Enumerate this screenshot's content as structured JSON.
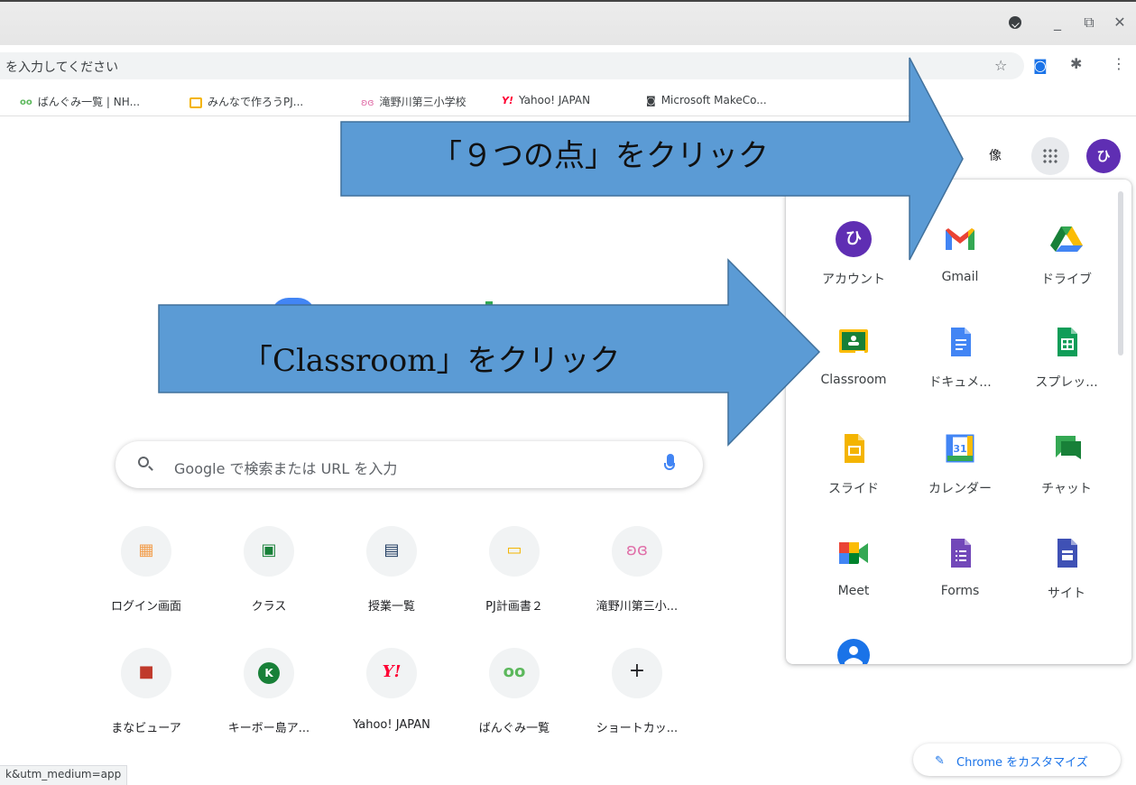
{
  "window": {
    "minimize": "_",
    "restore": "⧉",
    "close": "✕"
  },
  "omnibox": {
    "text": "を入力してください"
  },
  "bookmarks": [
    {
      "label": "ばんぐみ一覧 | NH...",
      "icon": "nhk-icon",
      "color": "#5cb85c"
    },
    {
      "label": "みんなで作ろうPJ...",
      "icon": "slides-icon",
      "color": "#f4b400"
    },
    {
      "label": "滝野川第三小学校",
      "icon": "school-icon",
      "color": "#e06fa8"
    },
    {
      "label": "Yahoo! JAPAN",
      "icon": "yahoo-icon",
      "color": "#ff0033"
    },
    {
      "label": "Microsoft MakeCo...",
      "icon": "makecode-icon",
      "color": "#3c4043"
    }
  ],
  "header": {
    "partial_text": "像",
    "avatar_letter": "ひ"
  },
  "search": {
    "placeholder": "Google で検索または URL を入力"
  },
  "shortcuts_row1": [
    {
      "label": "ログイン画面",
      "glyph": "▦",
      "color": "#f29e4c"
    },
    {
      "label": "クラス",
      "glyph": "▣",
      "color": "#188038"
    },
    {
      "label": "授業一覧",
      "glyph": "▤",
      "color": "#1e3a5f"
    },
    {
      "label": "PJ計画書２",
      "glyph": "▭",
      "color": "#f4b400"
    },
    {
      "label": "滝野川第三小...",
      "glyph": "ʚɞ",
      "color": "#e06fa8"
    }
  ],
  "shortcuts_row2": [
    {
      "label": "まなビューア",
      "glyph": "■",
      "color": "#c0392b"
    },
    {
      "label": "キーボー島ア...",
      "glyph": "K",
      "color": "#ffffff"
    },
    {
      "label": "Yahoo! JAPAN",
      "glyph": "Y!",
      "color": "#ff0033"
    },
    {
      "label": "ばんぐみ一覧",
      "glyph": "oo",
      "color": "#5cb85c"
    },
    {
      "label": "ショートカッ...",
      "glyph": "+",
      "color": "#202124"
    }
  ],
  "customize": {
    "label": "Chrome をカスタマイズ"
  },
  "status": {
    "text": "k&utm_medium=app"
  },
  "apps": [
    {
      "label": "アカウント",
      "icon": "account-icon"
    },
    {
      "label": "Gmail",
      "icon": "gmail-icon"
    },
    {
      "label": "ドライブ",
      "icon": "drive-icon"
    },
    {
      "label": "Classroom",
      "icon": "classroom-icon"
    },
    {
      "label": "ドキュメ...",
      "icon": "docs-icon"
    },
    {
      "label": "スプレッ...",
      "icon": "sheets-icon"
    },
    {
      "label": "スライド",
      "icon": "slides-icon"
    },
    {
      "label": "カレンダー",
      "icon": "calendar-icon"
    },
    {
      "label": "チャット",
      "icon": "chat-icon"
    },
    {
      "label": "Meet",
      "icon": "meet-icon"
    },
    {
      "label": "Forms",
      "icon": "forms-icon"
    },
    {
      "label": "サイト",
      "icon": "sites-icon"
    }
  ],
  "annotations": {
    "arrow1": "「９つの点」をクリック",
    "arrow2": "「Classroom」をクリック",
    "color": "#5b9bd5"
  }
}
